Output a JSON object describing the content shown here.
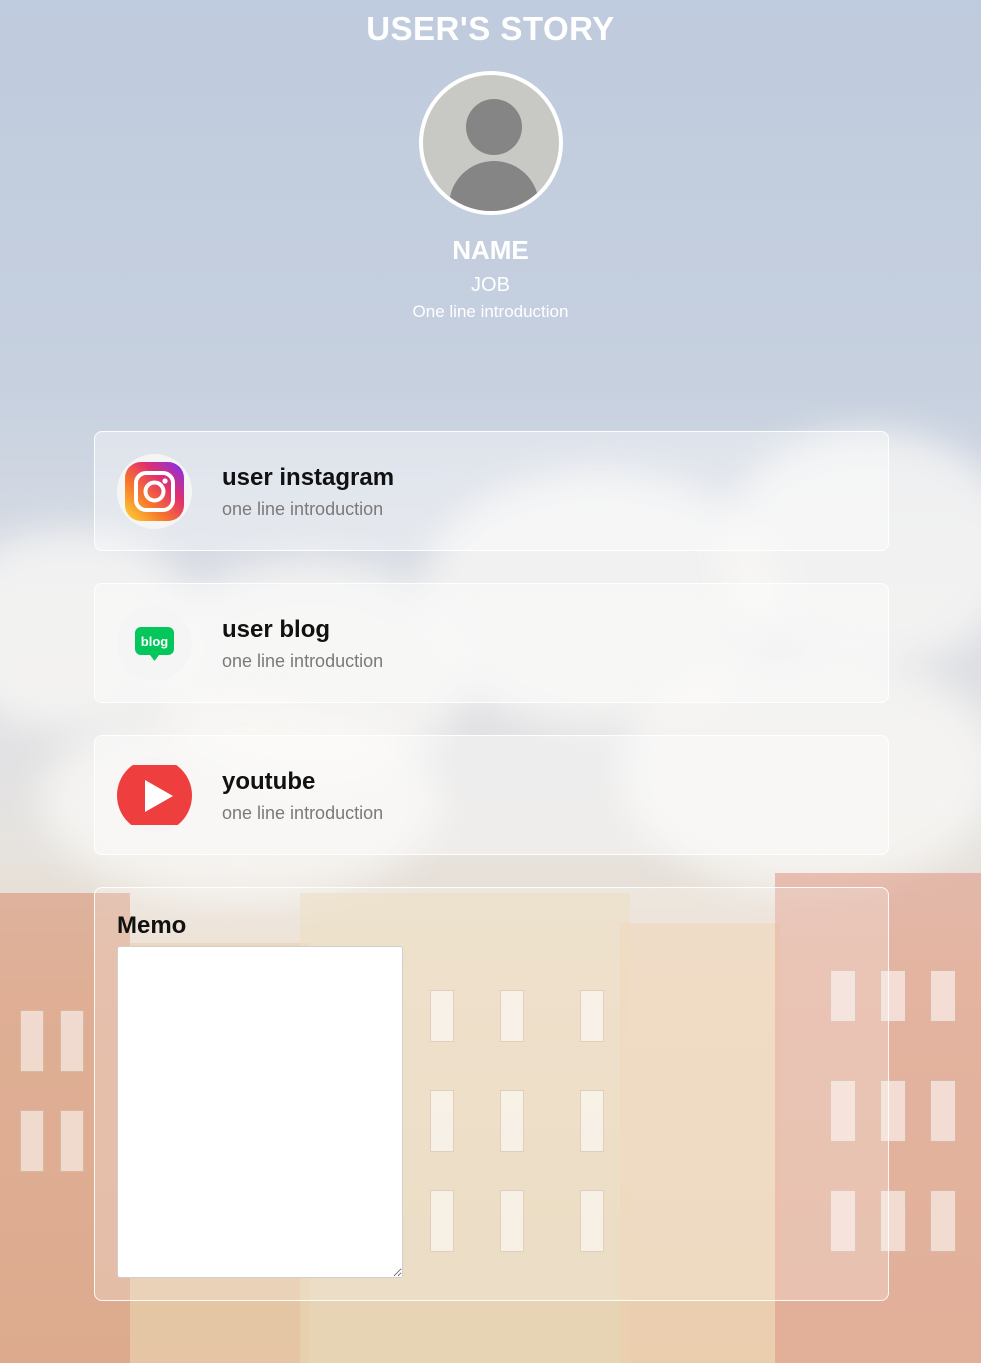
{
  "header": {
    "title": "USER'S STORY",
    "name": "NAME",
    "job": "JOB",
    "intro": "One line introduction"
  },
  "links": [
    {
      "title": "user instagram",
      "subtitle": "one line introduction",
      "icon": "instagram-icon"
    },
    {
      "title": "user blog",
      "subtitle": "one line introduction",
      "icon": "blog-icon",
      "icon_text": "blog"
    },
    {
      "title": "youtube",
      "subtitle": "one line introduction",
      "icon": "youtube-icon"
    }
  ],
  "memo": {
    "label": "Memo",
    "value": "",
    "placeholder": ""
  },
  "colors": {
    "blog_green": "#03c75a",
    "youtube_red": "#ee3e3e",
    "header_text": "#ffffff"
  }
}
